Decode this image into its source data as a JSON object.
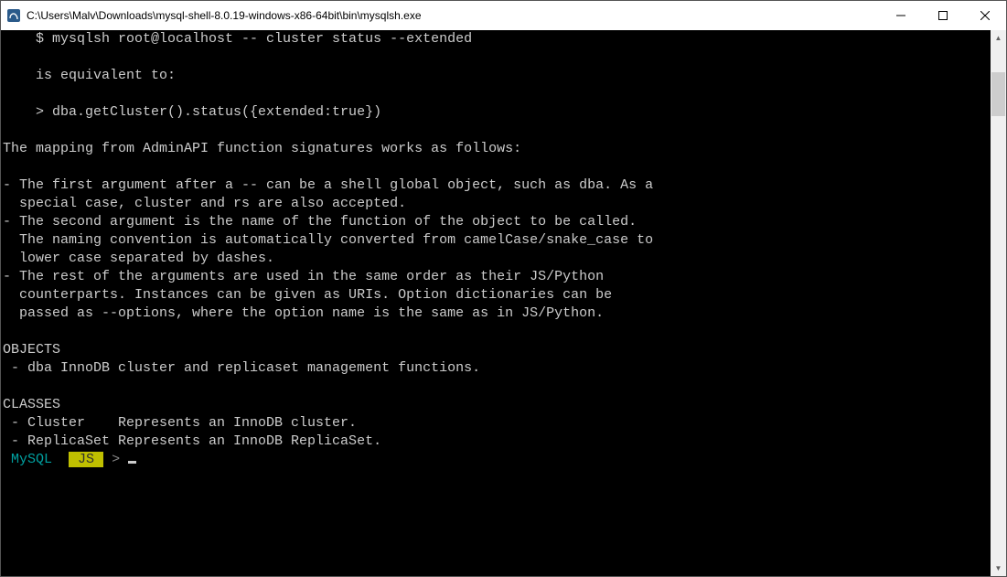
{
  "window": {
    "title": "C:\\Users\\Malv\\Downloads\\mysql-shell-8.0.19-windows-x86-64bit\\bin\\mysqlsh.exe"
  },
  "term": {
    "l00": "    $ mysqlsh root@localhost -- cluster status --extended",
    "l01": "",
    "l02": "    is equivalent to:",
    "l03": "",
    "l04": "    > dba.getCluster().status({extended:true})",
    "l05": "",
    "l06": "The mapping from AdminAPI function signatures works as follows:",
    "l07": "",
    "l08": "- The first argument after a -- can be a shell global object, such as dba. As a",
    "l09": "  special case, cluster and rs are also accepted.",
    "l10": "- The second argument is the name of the function of the object to be called.",
    "l11": "  The naming convention is automatically converted from camelCase/snake_case to",
    "l12": "  lower case separated by dashes.",
    "l13": "- The rest of the arguments are used in the same order as their JS/Python",
    "l14": "  counterparts. Instances can be given as URIs. Option dictionaries can be",
    "l15": "  passed as --options, where the option name is the same as in JS/Python.",
    "l16": "",
    "l17": "OBJECTS",
    "l18": " - dba InnoDB cluster and replicaset management functions.",
    "l19": "",
    "l20": "CLASSES",
    "l21": " - Cluster    Represents an InnoDB cluster.",
    "l22": " - ReplicaSet Represents an InnoDB ReplicaSet."
  },
  "prompt": {
    "mysql": " MySQL ",
    "js": " JS ",
    "gt": ">"
  }
}
